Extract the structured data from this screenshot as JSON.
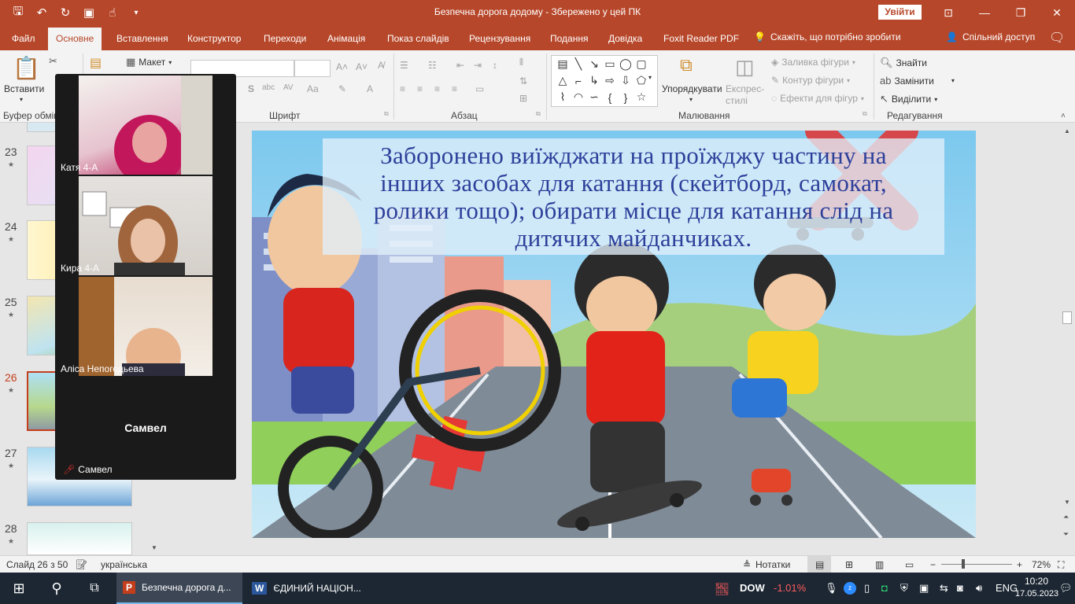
{
  "window": {
    "title": "Безпечна дорога додому  -  Збережено у цей ПК",
    "signin_label": "Увійти"
  },
  "tabs": [
    "Файл",
    "Основне",
    "Вставлення",
    "Конструктор",
    "Переходи",
    "Анімація",
    "Показ слайдів",
    "Рецензування",
    "Подання",
    "Довідка",
    "Foxit Reader PDF"
  ],
  "tellme": "Скажіть, що потрібно зробити",
  "share_label": "Спільний доступ",
  "ribbon": {
    "paste_label": "Вставити",
    "layout_label": "Макет",
    "arrange_label": "Упорядкувати",
    "express_styles_label": "Експрес-\nстилі",
    "shape_fill_label": "Заливка фігури",
    "shape_outline_label": "Контур фігури",
    "shape_effects_label": "Ефекти для фігур",
    "find_label": "Знайти",
    "replace_label": "Замінити",
    "select_label": "Виділити",
    "groups": {
      "clipboard": "Буфер обмін",
      "font": "Шрифт",
      "paragraph": "Абзац",
      "drawing": "Малювання",
      "editing": "Редагування"
    }
  },
  "thumbnails": [
    {
      "number": "23"
    },
    {
      "number": "24"
    },
    {
      "number": "25"
    },
    {
      "number": "26",
      "selected": true
    },
    {
      "number": "27"
    },
    {
      "number": "28"
    }
  ],
  "zoom": {
    "participants": [
      {
        "name": "Катя  4-А"
      },
      {
        "name": "Кира 4-А"
      },
      {
        "name": "Аліса Непогодьева"
      }
    ],
    "audio_only_name": "Самвел",
    "audio_only_footer": "Самвел"
  },
  "slide": {
    "title_lines": [
      "Заборонено виїжджати на проїжджу частину на",
      "інших засобах для катання (скейтборд, самокат,",
      "ролики тощо); обирати місце для катання слід на",
      "дитячих майданчиках."
    ]
  },
  "statusbar": {
    "slide_counter": "Слайд 26 з 50",
    "language": "українська",
    "notes_label": "Нотатки",
    "zoom_level": "72%"
  },
  "taskbar": {
    "apps": [
      {
        "label": "Безпечна дорога д..."
      },
      {
        "label": "ЄДИНИЙ НАЦІОН..."
      }
    ],
    "ticker": "DOW",
    "ticker_change": "-1.01%",
    "keyboard_lang": "ENG",
    "time": "10:20",
    "date": "17.05.2023"
  },
  "colors": {
    "accent": "#b7472a",
    "ticker_negative": "#ff5c5c"
  }
}
